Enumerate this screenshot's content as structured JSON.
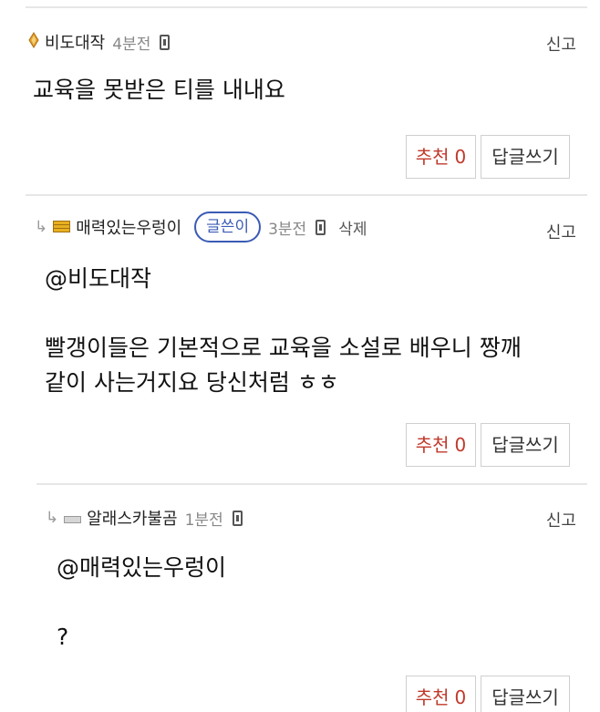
{
  "comments": [
    {
      "author": "비도대작",
      "time": "4분전",
      "report": "신고",
      "body": "교육을 못받은 티를 내내요",
      "recommend_label": "추천",
      "recommend_count": "0",
      "reply_label": "답글쓰기"
    },
    {
      "reply_arrow": "↳",
      "author": "매력있는우렁이",
      "badge": "글쓴이",
      "time": "3분전",
      "delete": "삭제",
      "report": "신고",
      "body": "@비도대작\n\n빨갱이들은 기본적으로 교육을 소설로 배우니 짱깨\n같이 사는거지요 당신처럼 ㅎㅎ",
      "recommend_label": "추천",
      "recommend_count": "0",
      "reply_label": "답글쓰기"
    },
    {
      "reply_arrow": "↳",
      "author": "알래스카불곰",
      "time": "1분전",
      "report": "신고",
      "body": "@매력있는우렁이\n\n?",
      "recommend_label": "추천",
      "recommend_count": "0",
      "reply_label": "답글쓰기"
    }
  ],
  "colors": {
    "recommend": "#c0392b",
    "badge": "#3b5bb5",
    "divider": "#e6e6e6"
  },
  "icons": [
    "diamond-level-icon",
    "gold-bar-level-icon",
    "gray-bar-level-icon",
    "mobile-icon",
    "reply-arrow-icon"
  ]
}
